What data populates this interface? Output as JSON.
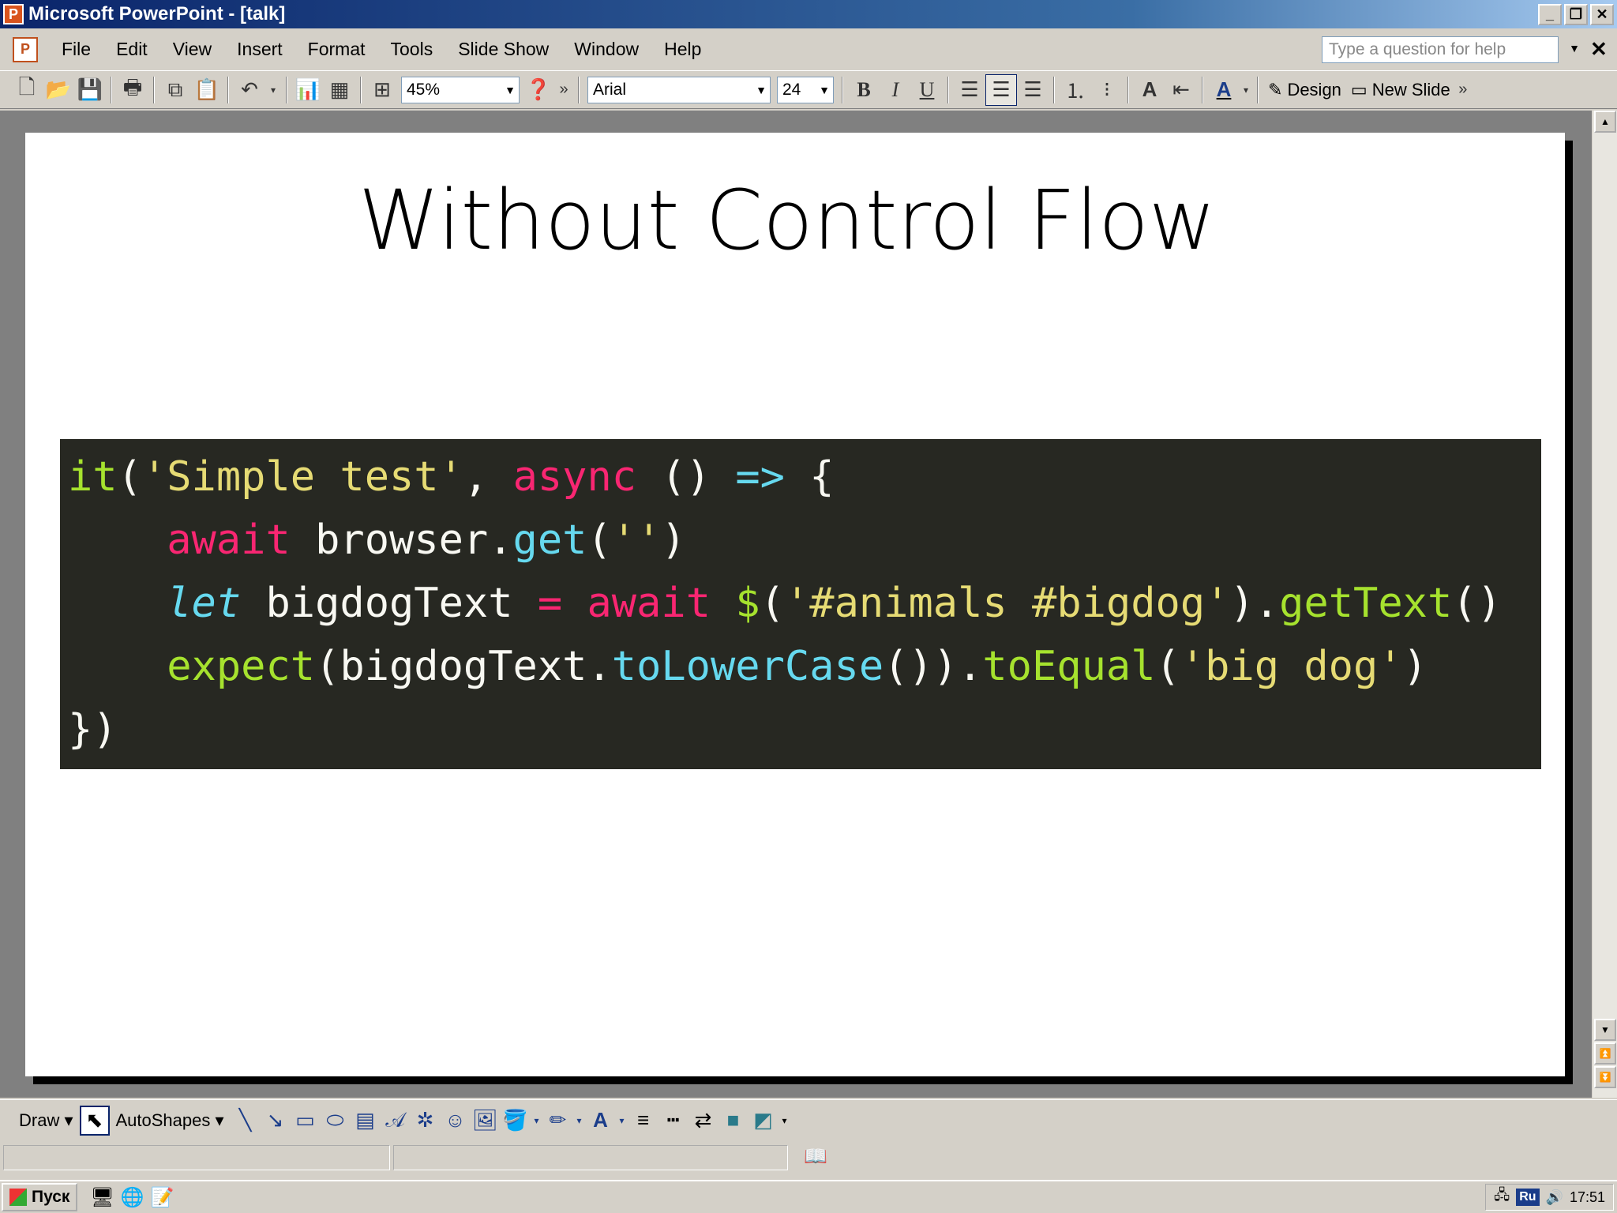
{
  "window": {
    "title": "Microsoft PowerPoint - [talk]",
    "app_icon": "P",
    "minimize": "_",
    "restore": "❐",
    "close": "✕"
  },
  "menu": {
    "items": [
      "File",
      "Edit",
      "View",
      "Insert",
      "Format",
      "Tools",
      "Slide Show",
      "Window",
      "Help"
    ],
    "help_placeholder": "Type a question for help",
    "doc_close": "✕"
  },
  "toolbar": {
    "zoom": "45%",
    "font": "Arial",
    "font_size": "24",
    "bold": "B",
    "italic": "I",
    "underline": "U",
    "design_label": "Design",
    "new_slide_label": "New Slide",
    "more": "»"
  },
  "slide": {
    "title": "Without Control Flow",
    "code_lines": [
      [
        {
          "t": "it",
          "c": "c-fn"
        },
        {
          "t": "(",
          "c": ""
        },
        {
          "t": "'Simple test'",
          "c": "c-str"
        },
        {
          "t": ", ",
          "c": ""
        },
        {
          "t": "async",
          "c": "c-kw"
        },
        {
          "t": " () ",
          "c": ""
        },
        {
          "t": "=>",
          "c": "c-op"
        },
        {
          "t": " {",
          "c": ""
        }
      ],
      [
        {
          "t": "    ",
          "c": ""
        },
        {
          "t": "await",
          "c": "c-kw"
        },
        {
          "t": " browser.",
          "c": ""
        },
        {
          "t": "get",
          "c": "c-prop"
        },
        {
          "t": "(",
          "c": ""
        },
        {
          "t": "''",
          "c": "c-str"
        },
        {
          "t": ")",
          "c": ""
        }
      ],
      [
        {
          "t": "    ",
          "c": ""
        },
        {
          "t": "let",
          "c": "c-let"
        },
        {
          "t": " bigdogText ",
          "c": ""
        },
        {
          "t": "=",
          "c": "c-kw"
        },
        {
          "t": " ",
          "c": ""
        },
        {
          "t": "await",
          "c": "c-kw"
        },
        {
          "t": " ",
          "c": ""
        },
        {
          "t": "$",
          "c": "c-fn"
        },
        {
          "t": "(",
          "c": ""
        },
        {
          "t": "'#animals #bigdog'",
          "c": "c-str"
        },
        {
          "t": ").",
          "c": ""
        },
        {
          "t": "getText",
          "c": "c-fn"
        },
        {
          "t": "()",
          "c": ""
        }
      ],
      [
        {
          "t": "    ",
          "c": ""
        },
        {
          "t": "expect",
          "c": "c-fn"
        },
        {
          "t": "(bigdogText.",
          "c": ""
        },
        {
          "t": "toLowerCase",
          "c": "c-prop"
        },
        {
          "t": "()).",
          "c": ""
        },
        {
          "t": "toEqual",
          "c": "c-fn"
        },
        {
          "t": "(",
          "c": ""
        },
        {
          "t": "'big dog'",
          "c": "c-str"
        },
        {
          "t": ")",
          "c": ""
        }
      ],
      [
        {
          "t": "})",
          "c": ""
        }
      ]
    ]
  },
  "drawbar": {
    "draw_label": "Draw ▾",
    "autoshapes_label": "AutoShapes ▾"
  },
  "taskbar": {
    "start_label": "Пуск",
    "lang": "Ru",
    "clock": "17:51"
  },
  "colors": {
    "code_bg": "#272822",
    "keyword": "#f92672",
    "function": "#a6e22e",
    "string": "#e6db74",
    "property": "#66d9ef"
  }
}
